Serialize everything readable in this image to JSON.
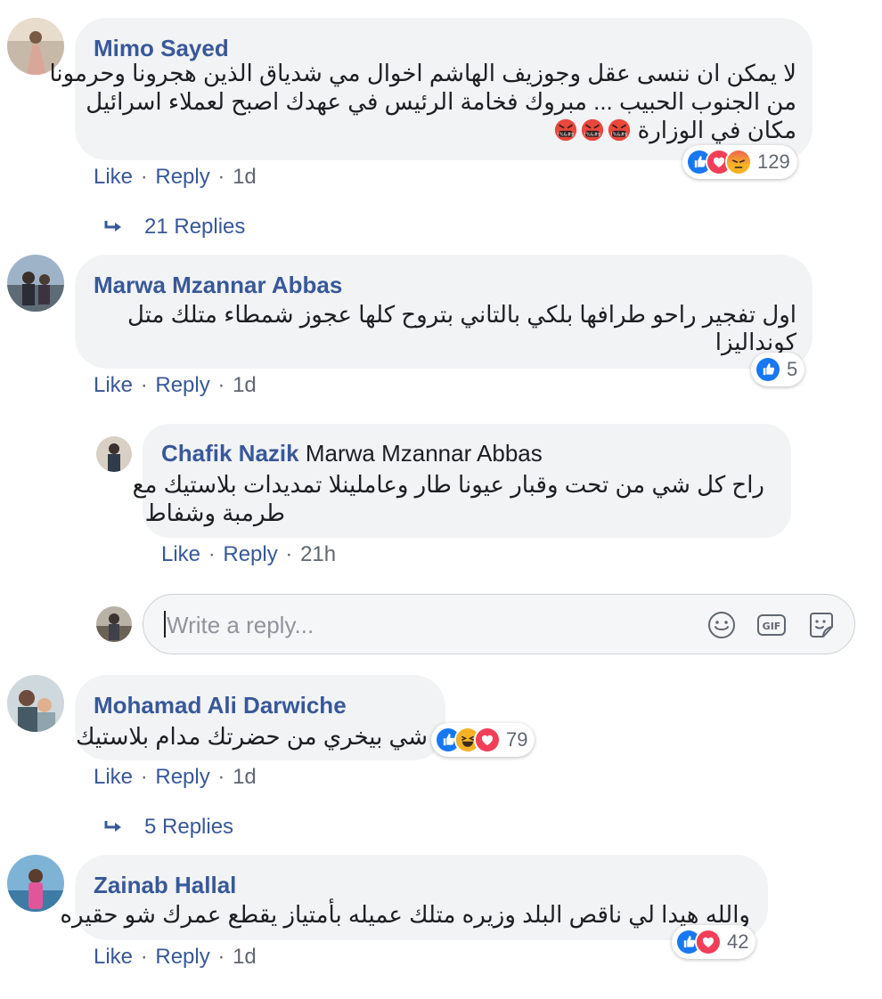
{
  "comments": [
    {
      "author": "Mimo Sayed",
      "lines": [
        "لا يمكن ان ننسى عقل وجوزيف الهاشم اخوال مي شدياق الذين هجرونا وحرمونا",
        "من الجنوب الحبيب ... مبروك فخامة الرئيس في عهدك اصبح لعملاء اسرائيل",
        "مكان في الوزارة"
      ],
      "reactions_count": "129",
      "like": "Like",
      "reply": "Reply",
      "time": "1d",
      "replies_label": "21 Replies"
    },
    {
      "author": "Marwa Mzannar Abbas",
      "lines": [
        "اول تفجير راحو طرافها بلكي بالتاني بتروح كلها عجوز شمطاء متلك متل",
        "كونداليزا"
      ],
      "reactions_count": "5",
      "like": "Like",
      "reply": "Reply",
      "time": "1d"
    },
    {
      "author": "Chafik Nazik",
      "mention": "Marwa Mzannar Abbas",
      "lines": [
        "راح كل شي من تحت وقبار عيونا طار وعاملينلا تمديدات بلاستيك مع",
        "طرمبة وشفاط"
      ],
      "like": "Like",
      "reply": "Reply",
      "time": "21h"
    },
    {
      "author": "Mohamad Ali Darwiche",
      "lines": [
        "شي بيخري من حضرتك مدام بلاستيك"
      ],
      "reactions_count": "79",
      "like": "Like",
      "reply": "Reply",
      "time": "1d",
      "replies_label": "5 Replies"
    },
    {
      "author": "Zainab Hallal",
      "lines": [
        "والله هيدا لي ناقص البلد وزيره متلك عميله بأمتياز يقطع عمرك شو حقيره"
      ],
      "reactions_count": "42",
      "like": "Like",
      "reply": "Reply",
      "time": "1d"
    }
  ],
  "reply_box": {
    "placeholder": "Write a reply..."
  },
  "colors": {
    "link": "#385898",
    "bubble": "#f2f3f5",
    "like_blue": "#1877f2",
    "love_red": "#f33e58",
    "haha_yellow": "#f7b125"
  },
  "icons": [
    "reply-arrow-icon",
    "like-icon",
    "love-icon",
    "angry-icon",
    "haha-icon",
    "smiley-icon",
    "gif-icon",
    "sticker-icon",
    "cursing-emoji-icon"
  ]
}
